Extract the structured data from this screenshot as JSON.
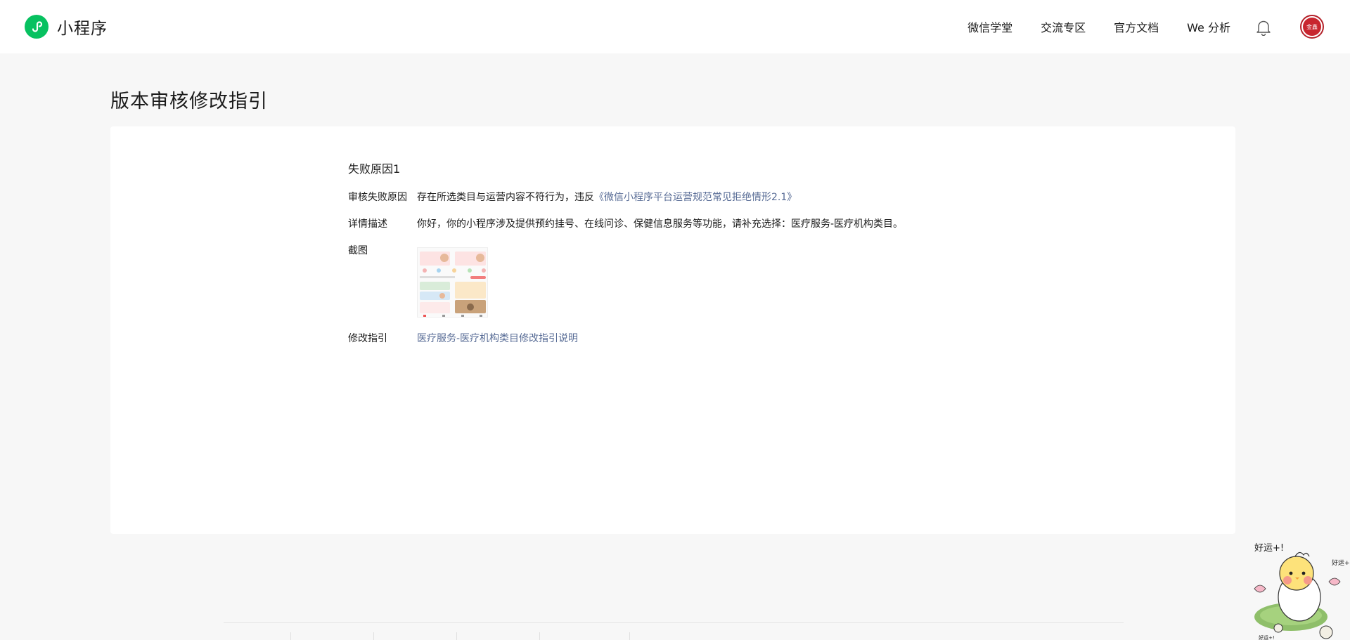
{
  "header": {
    "brand": "小程序",
    "nav": [
      "微信学堂",
      "交流专区",
      "官方文档",
      "We 分析"
    ],
    "avatar_text": "金鑫"
  },
  "page": {
    "title": "版本审核修改指引"
  },
  "failure": {
    "section_title": "失败原因1",
    "reason_label": "审核失败原因",
    "reason_text": "存在所选类目与运营内容不符行为，违反",
    "reason_link": "《微信小程序平台运营规范常见拒绝情形2.1》",
    "detail_label": "详情描述",
    "detail_text": "你好，你的小程序涉及提供预约挂号、在线问诊、保健信息服务等功能，请补充选择：医疗服务-医疗机构类目。",
    "screenshot_label": "截图",
    "guide_label": "修改指引",
    "guide_link": "医疗服务-医疗机构类目修改指引说明"
  },
  "sticker": {
    "text_top": "好运+!",
    "text_side": "好运+!",
    "text_bottom": "好运+!"
  },
  "colors": {
    "brand_green": "#07c160",
    "link_blue": "#576b95",
    "page_bg": "#f7f7f7",
    "avatar_red": "#c8262f"
  },
  "icons": [
    "miniprogram-logo-icon",
    "bell-icon",
    "avatar"
  ]
}
